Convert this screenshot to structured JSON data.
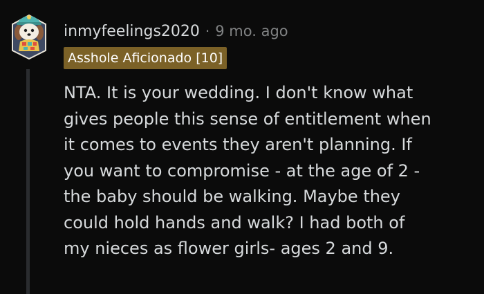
{
  "comment": {
    "username": "inmyfeelings2020",
    "separator": "·",
    "timestamp": "9 mo. ago",
    "flair": "Asshole Aficionado [10]",
    "avatar_icon": "dog-avatar-icon",
    "body_lines": [
      "NTA. It is your wedding. I don't know what",
      "gives people this sense of entitlement when",
      "it comes to events they aren't planning. If",
      "you want to compromise - at the age of 2 -",
      "the baby should be walking. Maybe they",
      "could hold hands and walk? I had both of",
      "my nieces as flower girls- ages 2 and 9."
    ]
  },
  "colors": {
    "background": "#0b0b0b",
    "text": "#d7dadc",
    "meta": "#818384",
    "flair_bg": "#7b6127",
    "thread_line": "#2a2c2f"
  }
}
